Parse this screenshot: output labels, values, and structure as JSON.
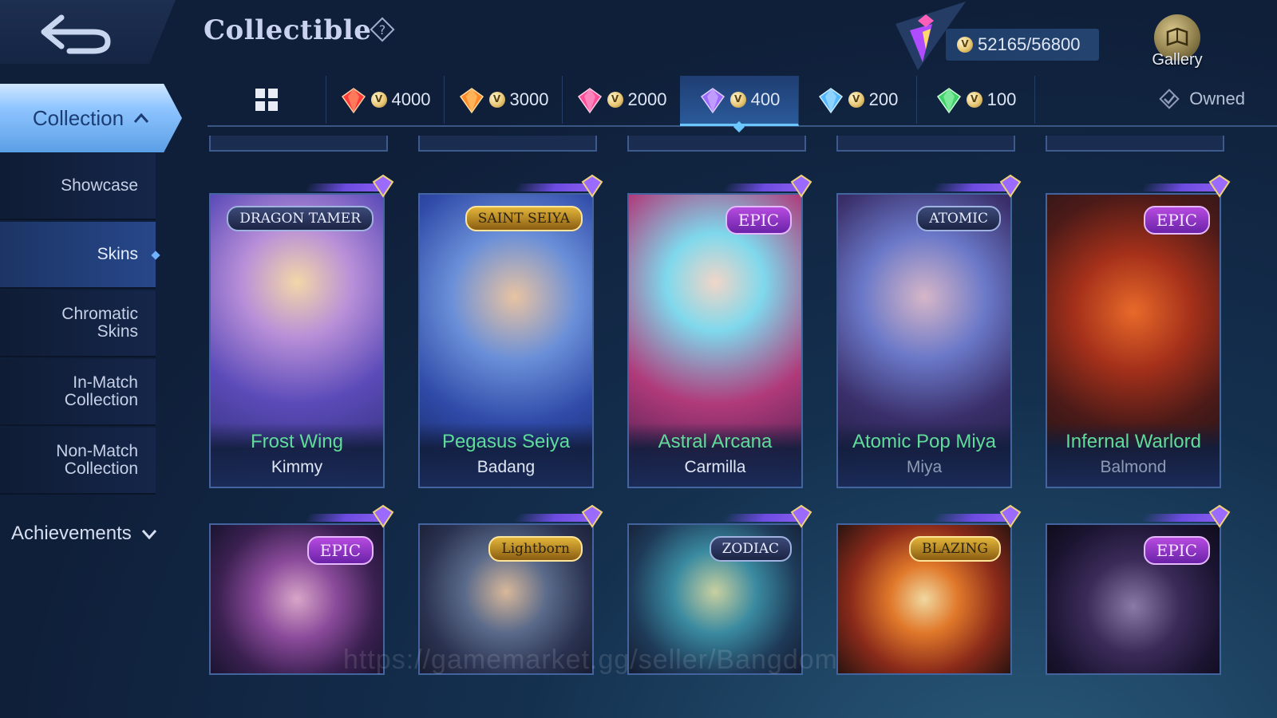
{
  "header": {
    "title": "Collectible",
    "points": "52165/56800",
    "gallery_label": "Gallery"
  },
  "sidebar": {
    "collection_label": "Collection",
    "items": [
      {
        "label": "Showcase"
      },
      {
        "label": "Skins"
      },
      {
        "label": "Chromatic Skins"
      },
      {
        "label": "In-Match Collection"
      },
      {
        "label": "Non-Match Collection"
      }
    ],
    "achievements_label": "Achievements"
  },
  "tabs": [
    {
      "value": "4000",
      "color": "#ff3c3c"
    },
    {
      "value": "3000",
      "color": "#ff8a2a"
    },
    {
      "value": "2000",
      "color": "#ff4e9a"
    },
    {
      "value": "400",
      "color": "#9b6bff"
    },
    {
      "value": "200",
      "color": "#53b8ff"
    },
    {
      "value": "100",
      "color": "#3fd16a"
    }
  ],
  "owned_label": "Owned",
  "cards": [
    {
      "skin": "Frost Wing",
      "hero": "Kimmy",
      "badge": "DRAGON TAMER"
    },
    {
      "skin": "Pegasus Seiya",
      "hero": "Badang",
      "badge": "SAINT SEIYA"
    },
    {
      "skin": "Astral Arcana",
      "hero": "Carmilla",
      "badge": "EPIC"
    },
    {
      "skin": "Atomic Pop Miya",
      "hero": "Miya",
      "badge": "ATOMIC"
    },
    {
      "skin": "Infernal Warlord",
      "hero": "Balmond",
      "badge": "EPIC"
    }
  ],
  "cards_row2": [
    {
      "badge": "EPIC"
    },
    {
      "badge": "Lightborn"
    },
    {
      "badge": "ZODIAC"
    },
    {
      "badge": "BLAZING"
    },
    {
      "badge": "EPIC"
    }
  ],
  "watermark": "https://gamemarket.gg/seller/Bangdom"
}
